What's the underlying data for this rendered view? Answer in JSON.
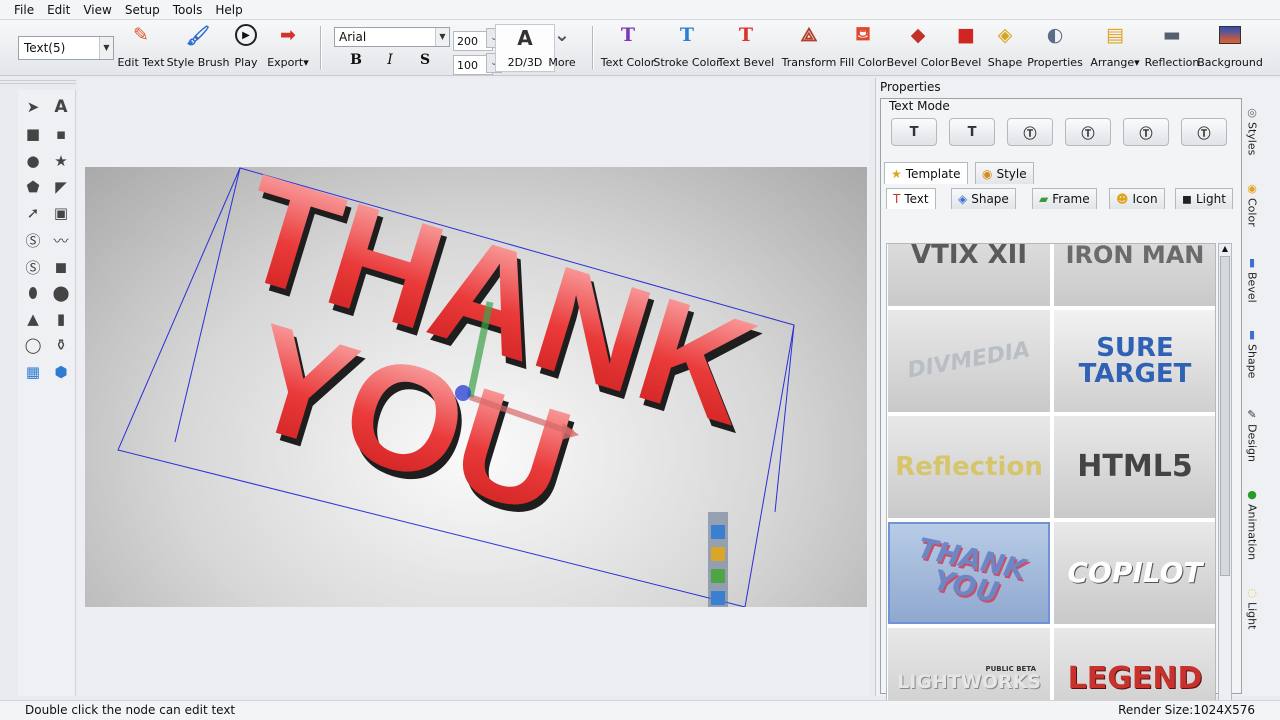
{
  "menu": [
    "File",
    "Edit",
    "View",
    "Setup",
    "Tools",
    "Help"
  ],
  "toolbar": {
    "object_selector": "Text(5)",
    "font": "Arial",
    "size_a": "200",
    "size_b": "100",
    "bold": "B",
    "italic": "I",
    "strike": "S",
    "buttons": {
      "edit_text": "Edit Text",
      "style_brush": "Style Brush",
      "play": "Play",
      "export": "Export",
      "mode_2d3d": "2D/3D",
      "more": "More",
      "text_color": "Text Color",
      "stroke_color": "Stroke Color",
      "text_bevel": "Text Bevel",
      "transform": "Transform",
      "fill_color": "Fill Color",
      "bevel_color": "Bevel Color",
      "bevel": "Bevel",
      "shape": "Shape",
      "properties": "Properties",
      "arrange": "Arrange",
      "reflection": "Reflection",
      "background": "Background"
    }
  },
  "canvas": {
    "line1": "THANK",
    "line2": "YOU"
  },
  "properties": {
    "title": "Properties",
    "text_mode": "Text Mode",
    "tabs": [
      "Template",
      "Style"
    ],
    "subtabs": [
      "Text",
      "Shape",
      "Frame",
      "Icon",
      "Light"
    ],
    "templates": [
      {
        "text": "VTIX XII",
        "color": "#5a5a5a"
      },
      {
        "text": "IRON MAN",
        "color": "#6b6b6b"
      },
      {
        "text": "DIVMEDIA",
        "color": "#b9bec4"
      },
      {
        "text": "SURE TARGET",
        "color": "#2f62b5"
      },
      {
        "text": "Reflection",
        "color": "#d6c56a"
      },
      {
        "text": "HTML5",
        "color": "#444444"
      },
      {
        "text": "THANK YOU",
        "color": "#6d87c4"
      },
      {
        "text": "COPILOT",
        "color": "#ffffff"
      },
      {
        "text": "LIGHTWORKS",
        "color": "#e6e6e6"
      },
      {
        "text": "PUBLIC BETA",
        "color": "#333333"
      },
      {
        "text": "LEGEND",
        "color": "#c8322c"
      }
    ]
  },
  "sidetabs": [
    "Styles",
    "Color",
    "Bevel",
    "Shape",
    "Design",
    "Animation",
    "Light"
  ],
  "status": {
    "hint": "Double click the node can edit text",
    "render_size": "Render Size:1024X576"
  }
}
